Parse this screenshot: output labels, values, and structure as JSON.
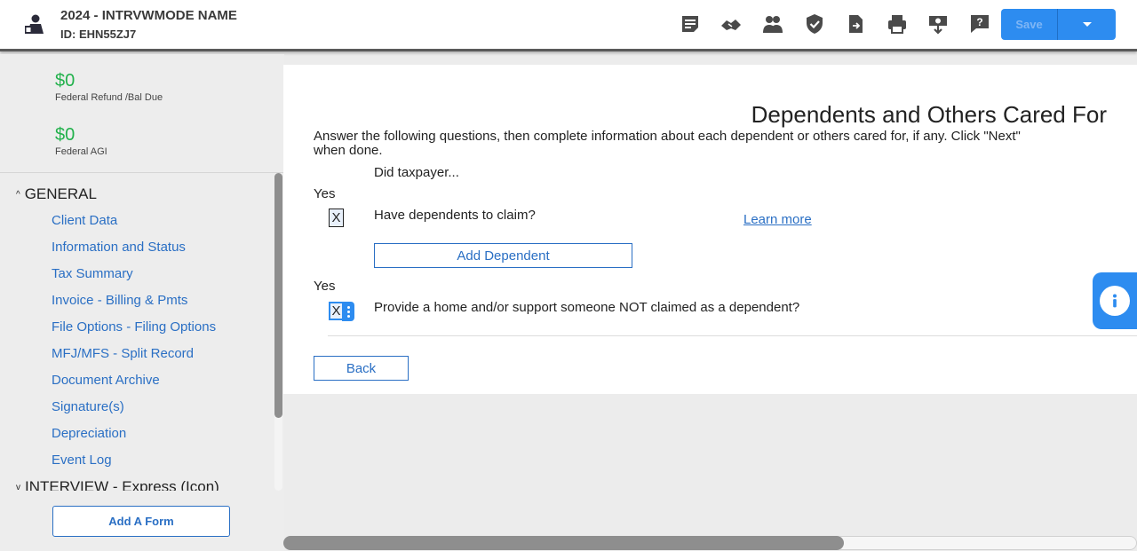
{
  "header": {
    "client_name": "2024 - INTRVWMODE NAME",
    "client_id": "ID: EHN55ZJ7",
    "save_label": "Save",
    "toolbar_icons": [
      "notes-icon",
      "handshake-icon",
      "users-icon",
      "shield-check-icon",
      "document-export-icon",
      "print-icon",
      "refund-download-icon",
      "help-icon"
    ]
  },
  "sidebar": {
    "federal_refund": {
      "amount": "$0",
      "label": "Federal Refund /Bal Due"
    },
    "federal_agi": {
      "amount": "$0",
      "label": "Federal AGI"
    },
    "sections": [
      {
        "title": "GENERAL",
        "expanded": true,
        "items": [
          "Client Data",
          "Information and Status",
          "Tax Summary",
          "Invoice - Billing & Pmts",
          "File Options - Filing Options",
          "MFJ/MFS - Split Record",
          "Document Archive",
          "Signature(s)",
          "Depreciation",
          "Event Log"
        ]
      },
      {
        "title": "INTERVIEW - Express (Icon)",
        "expanded": false
      }
    ],
    "add_form_label": "Add A Form"
  },
  "main": {
    "title": "Dependents and Others Cared For",
    "instructions": "Answer the following questions, then complete information about each dependent or others cared for, if any. Click \"Next\" when done.",
    "did_taxpayer": "Did taxpayer...",
    "questions": [
      {
        "yes_label": "Yes",
        "checkbox_value": "X",
        "text": "Have dependents to claim?"
      },
      {
        "yes_label": "Yes",
        "checkbox_value": "X",
        "text": "Provide a home and/or support someone NOT claimed as a dependent?"
      }
    ],
    "learn_more": "Learn more",
    "add_dependent_label": "Add Dependent",
    "back_label": "Back"
  },
  "colors": {
    "accent": "#2d8cf0",
    "link": "#2a6fc4",
    "money": "#22b14c"
  }
}
